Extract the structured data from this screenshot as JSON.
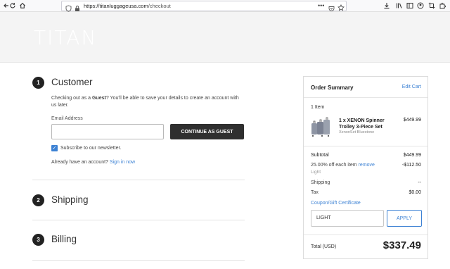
{
  "browser": {
    "url_host": "https://titanluggageusa.com",
    "url_path": "/checkout"
  },
  "site": {
    "logo": "TITAN"
  },
  "customer": {
    "step_number": "1",
    "title": "Customer",
    "guest_text_1": "Checking out as a ",
    "guest_bold": "Guest",
    "guest_text_2": "? You'll be able to save your details to create an account with us later.",
    "email_label": "Email Address",
    "continue_label": "CONTINUE AS GUEST",
    "newsletter_label": "Subscribe to our newsletter.",
    "have_account": "Already have an account?",
    "sign_in": "Sign in now"
  },
  "shipping": {
    "step_number": "2",
    "title": "Shipping"
  },
  "billing": {
    "step_number": "3",
    "title": "Billing"
  },
  "summary": {
    "title": "Order Summary",
    "edit_cart": "Edit Cart",
    "item_count": "1 Item",
    "item": {
      "name_line1": "1 x XENON Spinner",
      "name_line2": "Trolley 3-Piece Set",
      "variant": "XenonSet Bluestone",
      "price": "$449.99"
    },
    "subtotal_label": "Subtotal",
    "subtotal_value": "$449.99",
    "discount_label": "25.00% off each item",
    "discount_remove": "remove",
    "discount_code": "Light",
    "discount_value": "-$112.50",
    "shipping_label": "Shipping",
    "shipping_value": "--",
    "tax_label": "Tax",
    "tax_value": "$0.00",
    "coupon_link": "Coupon/Gift Certificate",
    "coupon_value": "LIGHT",
    "apply_label": "APPLY",
    "total_label": "Total (USD)",
    "total_value": "$337.49"
  },
  "colors": {
    "accent": "#3d82d4",
    "dark_button": "#2f2f2f",
    "header_bg": "#f4f4f4"
  }
}
